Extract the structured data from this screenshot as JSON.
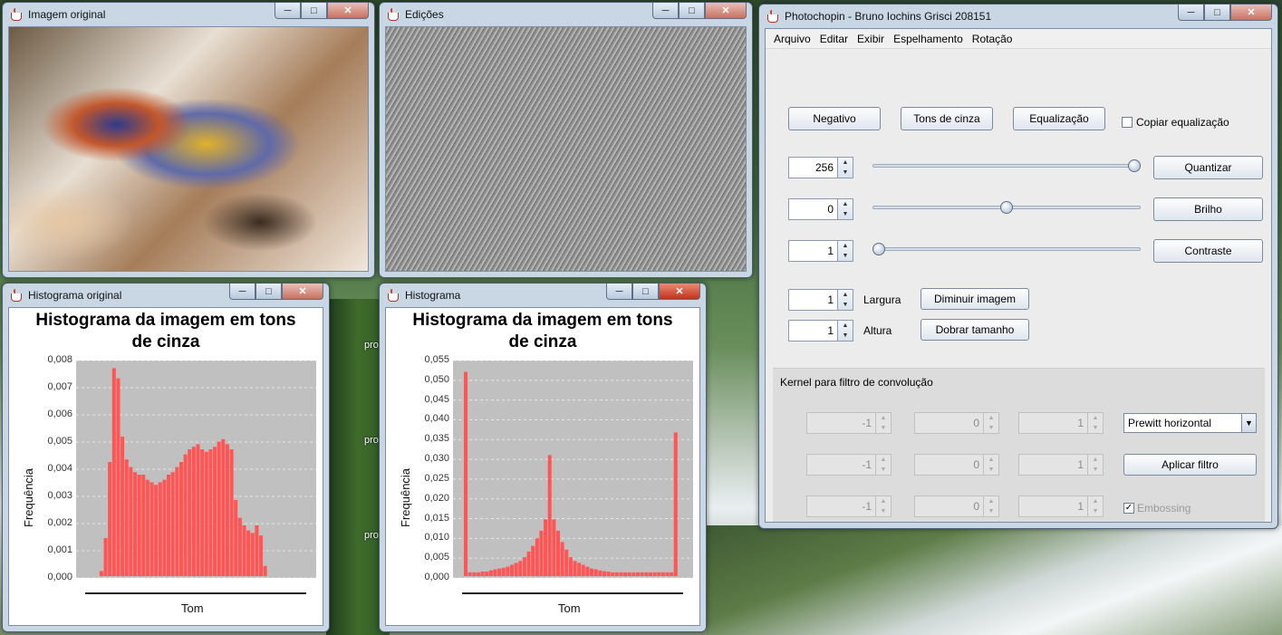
{
  "windows": {
    "original": {
      "title": "Imagem original"
    },
    "edits": {
      "title": "Edições"
    },
    "hist_original": {
      "title": "Histograma original",
      "chart_title": "Histograma da imagem em tons de cinza",
      "ylabel": "Frequência",
      "xlabel": "Tom",
      "yticks": [
        "0,008",
        "0,007",
        "0,006",
        "0,005",
        "0,004",
        "0,003",
        "0,002",
        "0,001",
        "0,000"
      ]
    },
    "hist_edit": {
      "title": "Histograma",
      "chart_title": "Histograma da imagem em tons de cinza",
      "ylabel": "Frequência",
      "xlabel": "Tom",
      "yticks": [
        "0,055",
        "0,050",
        "0,045",
        "0,040",
        "0,035",
        "0,030",
        "0,025",
        "0,020",
        "0,015",
        "0,010",
        "0,005",
        "0,000"
      ]
    },
    "main": {
      "title": "Photochopin - Bruno Iochins Grisci 208151"
    }
  },
  "menu": [
    "Arquivo",
    "Editar",
    "Exibir",
    "Espelhamento",
    "Rotação"
  ],
  "buttons": {
    "negativo": "Negativo",
    "tons_cinza": "Tons de cinza",
    "equalizacao": "Equalização",
    "quantizar": "Quantizar",
    "brilho": "Brilho",
    "contraste": "Contraste",
    "diminuir": "Diminuir imagem",
    "dobrar": "Dobrar tamanho",
    "aplicar": "Aplicar filtro"
  },
  "copy_eq_label": "Copiar equalização",
  "spinners": {
    "quantize": "256",
    "brightness": "0",
    "contrast": "1",
    "width": "1",
    "height": "1"
  },
  "sliders": {
    "quantize_level": 1.0,
    "brightness_level": 0.5,
    "contrast_level": 0.0
  },
  "labels": {
    "largura": "Largura",
    "altura": "Altura",
    "kernel": "Kernel para filtro de convolução",
    "embossing": "Embossing"
  },
  "kernel": [
    [
      "-1",
      "0",
      "1"
    ],
    [
      "-1",
      "0",
      "1"
    ],
    [
      "-1",
      "0",
      "1"
    ]
  ],
  "filter_select": "Prewitt horizontal",
  "desktop_labels": [
    "pro",
    "pro",
    "pro"
  ],
  "chart_data": [
    {
      "type": "bar",
      "title": "Histograma da imagem em tons de cinza",
      "xlabel": "Tom",
      "ylabel": "Frequência",
      "ylim": [
        0,
        0.0085
      ],
      "x": [
        0,
        5,
        10,
        15,
        20,
        25,
        30,
        35,
        40,
        45,
        50,
        55,
        60,
        65,
        70,
        75,
        80,
        85,
        90,
        95,
        100,
        105,
        110,
        115,
        120,
        125,
        130,
        135,
        140,
        145,
        150,
        155,
        160,
        165,
        170,
        175,
        180,
        185,
        190,
        195,
        200,
        205,
        210,
        215,
        220,
        225,
        230,
        235,
        240,
        245,
        250,
        255
      ],
      "values": [
        0,
        0,
        0,
        0.0002,
        0.0015,
        0.0045,
        0.0082,
        0.0078,
        0.0055,
        0.0046,
        0.0043,
        0.0041,
        0.004,
        0.004,
        0.0038,
        0.0037,
        0.0036,
        0.0037,
        0.0038,
        0.004,
        0.0041,
        0.0043,
        0.0045,
        0.0048,
        0.005,
        0.0051,
        0.0052,
        0.005,
        0.0049,
        0.005,
        0.0051,
        0.0053,
        0.0054,
        0.0052,
        0.005,
        0.003,
        0.0023,
        0.002,
        0.0018,
        0.0017,
        0.002,
        0.0016,
        0.0004,
        0,
        0,
        0,
        0,
        0,
        0,
        0,
        0,
        0
      ]
    },
    {
      "type": "bar",
      "title": "Histograma da imagem em tons de cinza",
      "xlabel": "Tom",
      "ylabel": "Frequência",
      "ylim": [
        0,
        0.057
      ],
      "x": [
        0,
        5,
        10,
        15,
        20,
        25,
        30,
        35,
        40,
        45,
        50,
        55,
        60,
        65,
        70,
        75,
        80,
        85,
        90,
        95,
        100,
        105,
        110,
        115,
        120,
        125,
        130,
        135,
        140,
        145,
        150,
        155,
        160,
        165,
        170,
        175,
        180,
        185,
        190,
        195,
        200,
        205,
        210,
        215,
        220,
        225,
        230,
        235,
        240,
        245,
        250,
        255
      ],
      "values": [
        0.054,
        0.001,
        0.001,
        0.001,
        0.0012,
        0.0012,
        0.0015,
        0.0018,
        0.002,
        0.0022,
        0.0025,
        0.003,
        0.0035,
        0.004,
        0.005,
        0.0065,
        0.008,
        0.01,
        0.012,
        0.015,
        0.032,
        0.015,
        0.012,
        0.009,
        0.007,
        0.005,
        0.004,
        0.0035,
        0.003,
        0.0025,
        0.002,
        0.0018,
        0.0015,
        0.0013,
        0.0012,
        0.001,
        0.001,
        0.001,
        0.001,
        0.001,
        0.001,
        0.001,
        0.001,
        0.001,
        0.001,
        0.001,
        0.001,
        0.001,
        0.001,
        0.001,
        0.038,
        0
      ]
    }
  ]
}
